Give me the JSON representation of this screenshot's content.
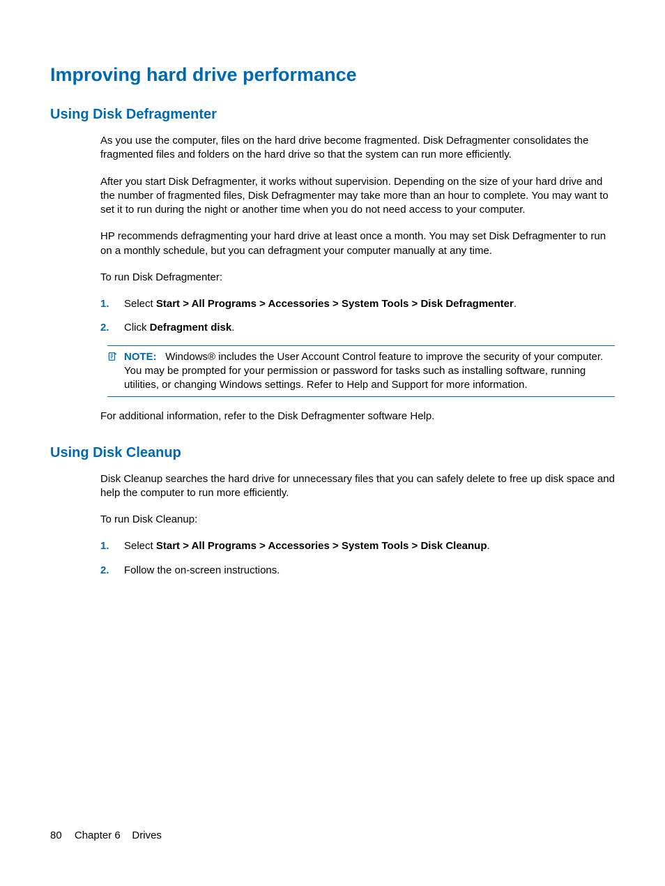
{
  "page": {
    "title": "Improving hard drive performance",
    "footer": {
      "page_number": "80",
      "chapter_label": "Chapter 6",
      "chapter_name": "Drives"
    }
  },
  "section1": {
    "heading": "Using Disk Defragmenter",
    "p1": "As you use the computer, files on the hard drive become fragmented. Disk Defragmenter consolidates the fragmented files and folders on the hard drive so that the system can run more efficiently.",
    "p2": "After you start Disk Defragmenter, it works without supervision. Depending on the size of your hard drive and the number of fragmented files, Disk Defragmenter may take more than an hour to complete. You may want to set it to run during the night or another time when you do not need access to your computer.",
    "p3": "HP recommends defragmenting your hard drive at least once a month. You may set Disk Defragmenter to run on a monthly schedule, but you can defragment your computer manually at any time.",
    "p4": "To run Disk Defragmenter:",
    "steps": [
      {
        "num": "1.",
        "pre": "Select ",
        "bold": "Start > All Programs > Accessories > System Tools > Disk Defragmenter",
        "post": "."
      },
      {
        "num": "2.",
        "pre": "Click ",
        "bold": "Defragment disk",
        "post": "."
      }
    ],
    "note": {
      "label": "NOTE:",
      "text": "Windows® includes the User Account Control feature to improve the security of your computer. You may be prompted for your permission or password for tasks such as installing software, running utilities, or changing Windows settings. Refer to Help and Support for more information."
    },
    "p5": "For additional information, refer to the Disk Defragmenter software Help."
  },
  "section2": {
    "heading": "Using Disk Cleanup",
    "p1": "Disk Cleanup searches the hard drive for unnecessary files that you can safely delete to free up disk space and help the computer to run more efficiently.",
    "p2": "To run Disk Cleanup:",
    "steps": [
      {
        "num": "1.",
        "pre": "Select ",
        "bold": "Start > All Programs > Accessories > System Tools > Disk Cleanup",
        "post": "."
      },
      {
        "num": "2.",
        "pre": "Follow the on-screen instructions.",
        "bold": "",
        "post": ""
      }
    ]
  }
}
